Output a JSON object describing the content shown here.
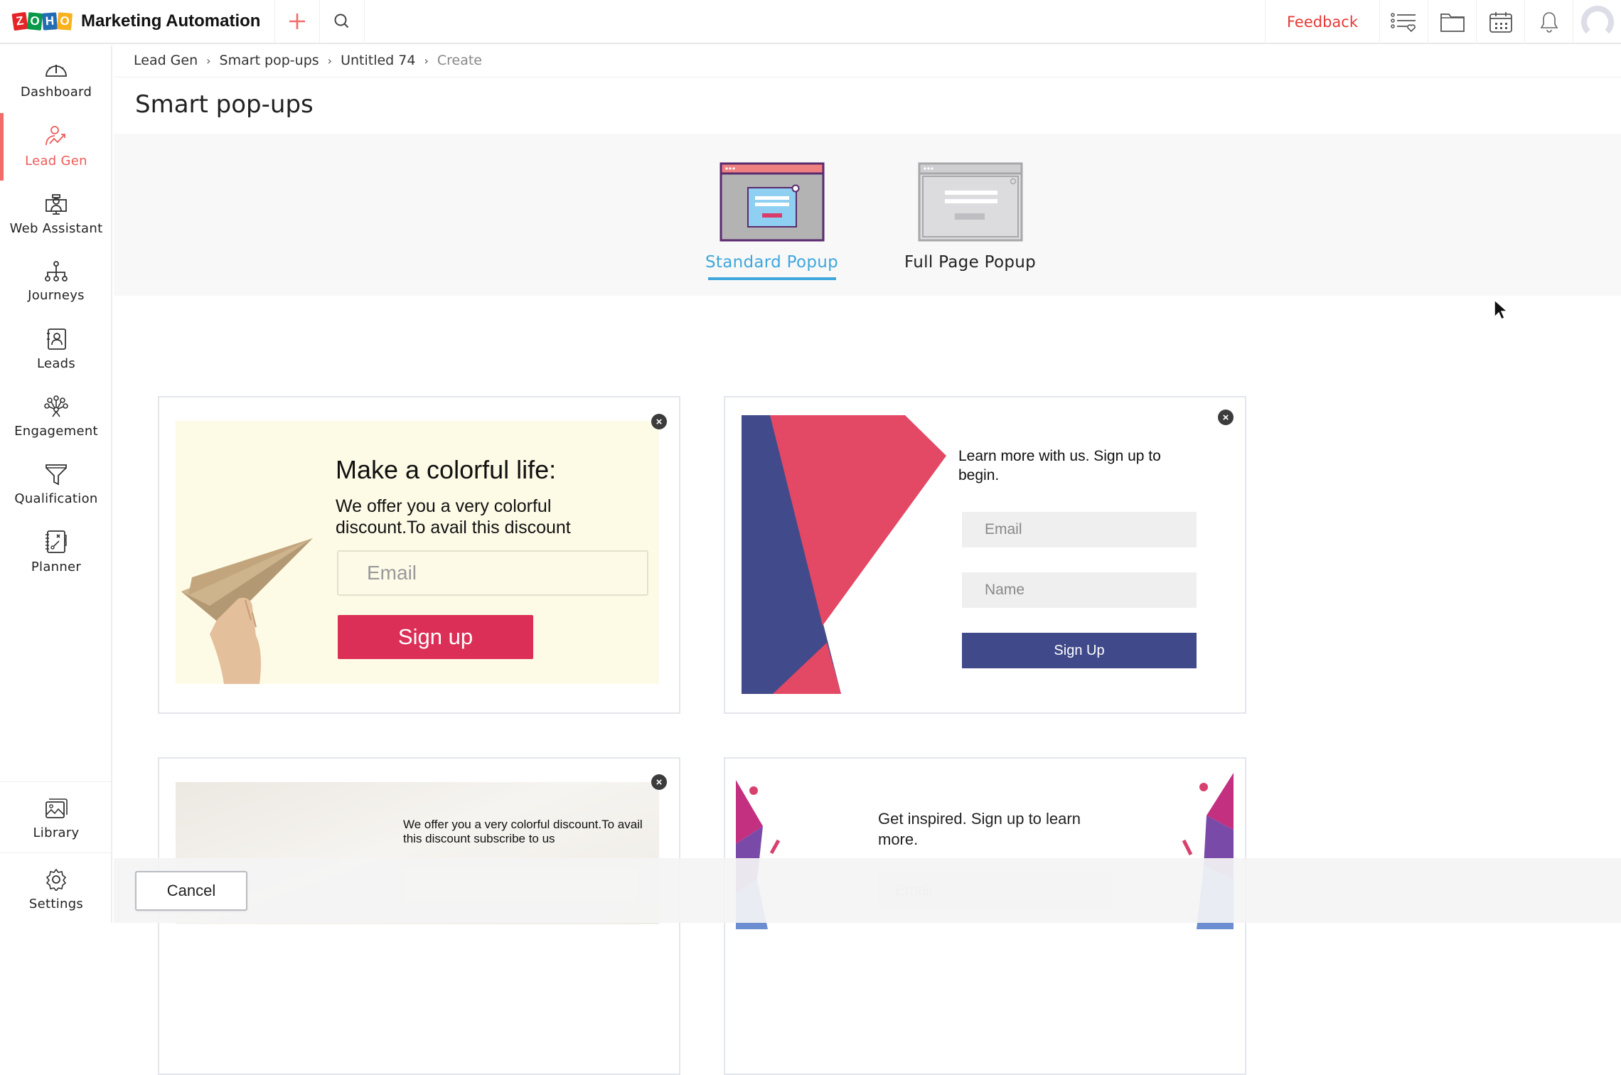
{
  "app": {
    "logo_letters": [
      "Z",
      "O",
      "H",
      "O"
    ],
    "logo_colors": [
      "#e42527",
      "#089949",
      "#226db4",
      "#f9b21d"
    ],
    "title": "Marketing Automation",
    "accent": "#f26a6a"
  },
  "header": {
    "add_icon": "plus-icon",
    "search_icon": "search-icon",
    "feedback_label": "Feedback",
    "tools": [
      "favorites-list-icon",
      "folder-icon",
      "calendar-icon",
      "bell-icon",
      "avatar"
    ]
  },
  "sidebar": {
    "items": [
      {
        "label": "Dashboard",
        "icon": "dashboard-icon",
        "active": false
      },
      {
        "label": "Lead Gen",
        "icon": "lead-gen-icon",
        "active": true
      },
      {
        "label": "Web Assistant",
        "icon": "web-assistant-icon",
        "active": false
      },
      {
        "label": "Journeys",
        "icon": "journeys-icon",
        "active": false
      },
      {
        "label": "Leads",
        "icon": "leads-icon",
        "active": false
      },
      {
        "label": "Engagement",
        "icon": "engagement-icon",
        "active": false
      },
      {
        "label": "Qualification",
        "icon": "funnel-icon",
        "active": false
      },
      {
        "label": "Planner",
        "icon": "planner-icon",
        "active": false
      }
    ],
    "bottom_items": [
      {
        "label": "Library",
        "icon": "library-icon"
      },
      {
        "label": "Settings",
        "icon": "gear-icon"
      }
    ]
  },
  "breadcrumb": {
    "items": [
      "Lead Gen",
      "Smart pop-ups",
      "Untitled 74"
    ],
    "current": "Create"
  },
  "page": {
    "title": "Smart pop-ups"
  },
  "popup_types": {
    "options": [
      {
        "label": "Standard Popup",
        "selected": true
      },
      {
        "label": "Full Page Popup",
        "selected": false
      }
    ],
    "selected_color": "#3fa7dc"
  },
  "templates": {
    "card1": {
      "title": "Make a colorful life:",
      "description": "We offer you a very colorful discount.To avail this discount",
      "email_placeholder": "Email",
      "button_label": "Sign up",
      "button_color": "#dc2f57",
      "bg_color": "#fdfbe6"
    },
    "card2": {
      "title": "Learn more with us. Sign up to begin.",
      "email_placeholder": "Email",
      "name_placeholder": "Name",
      "button_label": "Sign Up",
      "button_color": "#404a8a",
      "accent_color": "#e34865"
    },
    "card3": {
      "description": "We offer you a very colorful discount.To avail this discount subscribe to us",
      "email_placeholder": "Email"
    },
    "card4": {
      "description": "Get inspired. Sign up to learn more.",
      "email_placeholder": "Email"
    }
  },
  "footer": {
    "cancel_label": "Cancel"
  }
}
